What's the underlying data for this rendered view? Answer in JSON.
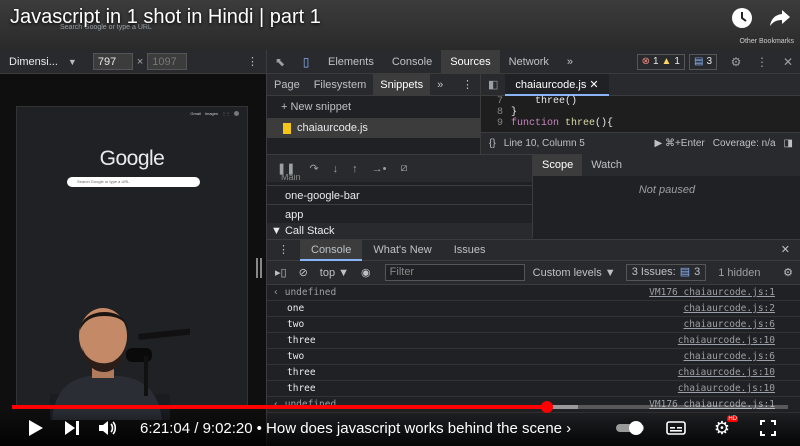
{
  "video": {
    "title": "Javascript in 1 shot in Hindi | part 1",
    "current_time": "6:21:04",
    "duration": "9:02:20",
    "time_separator": " / ",
    "chapter": "• How does javascript works behind the scene ›",
    "progress_played_fraction": 0.69,
    "progress_loaded_fraction": 0.73,
    "hd_badge": "HD"
  },
  "browser": {
    "omnibox_placeholder": "Search Google or type a URL",
    "bookmarks": "Other Bookmarks"
  },
  "device_toolbar": {
    "dimensions_label": "Dimensi...",
    "width": "797",
    "times": "×",
    "height": "1097"
  },
  "emulated_page": {
    "links": [
      "Gmail",
      "Images"
    ],
    "logo": "Google",
    "search_placeholder": "Search Google or type a URL"
  },
  "devtools": {
    "tabs": [
      "Elements",
      "Console",
      "Sources",
      "Network"
    ],
    "active_tab": "Sources",
    "more": "»",
    "error_count": "1",
    "warning_count": "1",
    "info_count": "3",
    "navigator_tabs": [
      "Page",
      "Filesystem",
      "Snippets"
    ],
    "active_navigator_tab": "Snippets",
    "new_snippet": "+ New snippet",
    "snippet_file": "chaiaurcode.js",
    "editor_file": "chaiaurcode.js",
    "code_lines": [
      {
        "num": "7",
        "text": "    three()"
      },
      {
        "num": "8",
        "text": "}"
      },
      {
        "num": "9",
        "kw": "function ",
        "fn": "three",
        "rest": "(){"
      }
    ],
    "status": {
      "braces": "{}",
      "position": "Line 10, Column 5",
      "run": "▶ ⌘+Enter",
      "coverage": "Coverage: n/a"
    },
    "threads_label": "Main",
    "threads": [
      "one-google-bar",
      "app"
    ],
    "call_stack": "▼ Call Stack",
    "scope_tabs": [
      "Scope",
      "Watch"
    ],
    "not_paused": "Not paused"
  },
  "drawer": {
    "tabs": [
      "Console",
      "What's New",
      "Issues"
    ],
    "context": "top",
    "filter_placeholder": "Filter",
    "levels": "Custom levels ▼",
    "issues": "3 Issues:",
    "issues_count": "3",
    "hidden": "1 hidden"
  },
  "console_log": [
    {
      "msg": "undefined",
      "src": "VM176 chaiaurcode.js:1",
      "kind": "result"
    },
    {
      "msg": "one",
      "src": "chaiaurcode.js:2"
    },
    {
      "msg": "two",
      "src": "chaiaurcode.js:6"
    },
    {
      "msg": "three",
      "src": "chaiaurcode.js:10"
    },
    {
      "msg": "two",
      "src": "chaiaurcode.js:6"
    },
    {
      "msg": "three",
      "src": "chaiaurcode.js:10"
    },
    {
      "msg": "three",
      "src": "chaiaurcode.js:10"
    },
    {
      "msg": "undefined",
      "src": "VM176 chaiaurcode.js:1",
      "kind": "result"
    }
  ],
  "colors": {
    "accent": "#8ab4f8",
    "progress_red": "#ff0000",
    "snippet_icon": "#f5c518"
  }
}
